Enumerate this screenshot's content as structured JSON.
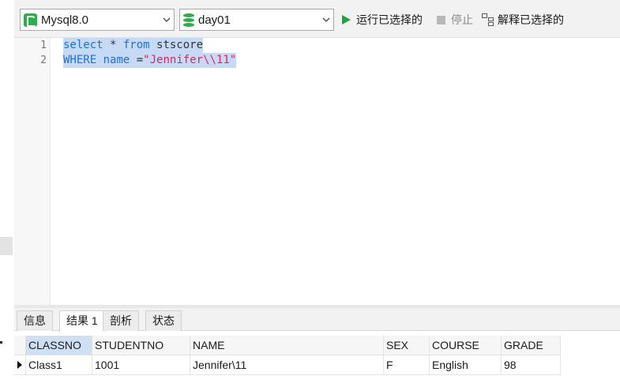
{
  "toolbar": {
    "connection": "Mysql8.0",
    "database": "day01",
    "run_label": "运行已选择的",
    "stop_label": "停止",
    "explain_label": "解释已选择的"
  },
  "editor": {
    "line_numbers": [
      "1",
      "2"
    ],
    "line1": {
      "kw1": "select",
      "op": " * ",
      "kw2": "from",
      "table": " stscore"
    },
    "line2": {
      "kw1": "WHERE",
      "col": " name ",
      "op": "=",
      "str": "\"Jennifer\\\\11\""
    }
  },
  "result_tabs": [
    "信息",
    "结果 1",
    "剖析",
    "状态"
  ],
  "table": {
    "columns": [
      "CLASSNO",
      "STUDENTNO",
      "NAME",
      "SEX",
      "COURSE",
      "GRADE"
    ],
    "rows": [
      [
        "Class1",
        "1001",
        "Jennifer\\11",
        "F",
        "English",
        "98"
      ]
    ]
  },
  "colors": {
    "run_green": "#1ea33b",
    "keyword_blue": "#1e6fd9",
    "string_red": "#e0245e",
    "selection": "#c6daf6"
  }
}
